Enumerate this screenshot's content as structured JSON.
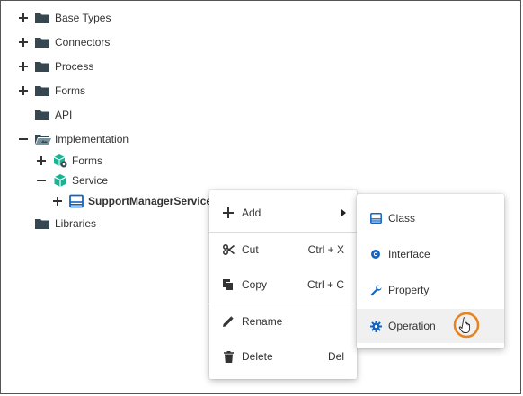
{
  "tree": {
    "items": [
      {
        "label": "Base Types",
        "expander": "plus",
        "icon": "folder-icon"
      },
      {
        "label": "Connectors",
        "expander": "plus",
        "icon": "folder-icon"
      },
      {
        "label": "Process",
        "expander": "plus",
        "icon": "folder-icon"
      },
      {
        "label": "Forms",
        "expander": "plus",
        "icon": "folder-icon"
      },
      {
        "label": "API",
        "expander": "none",
        "icon": "folder-icon"
      },
      {
        "label": "Implementation",
        "expander": "minus",
        "icon": "folder-open-icon"
      },
      {
        "label": "Forms",
        "expander": "plus",
        "icon": "package-icon"
      },
      {
        "label": "Service",
        "expander": "minus",
        "icon": "package-icon"
      },
      {
        "label": "SupportManagerService",
        "expander": "plus",
        "icon": "class-icon"
      },
      {
        "label": "Libraries",
        "expander": "none",
        "icon": "folder-icon"
      }
    ]
  },
  "context_menu": {
    "items": [
      {
        "label": "Add",
        "shortcut": "",
        "icon": "plus-icon",
        "has_submenu": true
      },
      {
        "label": "Cut",
        "shortcut": "Ctrl + X",
        "icon": "scissors-icon"
      },
      {
        "label": "Copy",
        "shortcut": "Ctrl + C",
        "icon": "copy-icon"
      },
      {
        "label": "Rename",
        "shortcut": "",
        "icon": "pencil-icon"
      },
      {
        "label": "Delete",
        "shortcut": "Del",
        "icon": "trash-icon"
      }
    ]
  },
  "submenu": {
    "items": [
      {
        "label": "Class",
        "icon": "class-icon"
      },
      {
        "label": "Interface",
        "icon": "interface-icon"
      },
      {
        "label": "Property",
        "icon": "wrench-icon"
      },
      {
        "label": "Operation",
        "icon": "gear-icon",
        "highlighted": true
      }
    ]
  },
  "colors": {
    "folder": "#37474f",
    "package": "#1ab394",
    "class_blue": "#1565c0",
    "cursor_ring": "#e8821e"
  }
}
